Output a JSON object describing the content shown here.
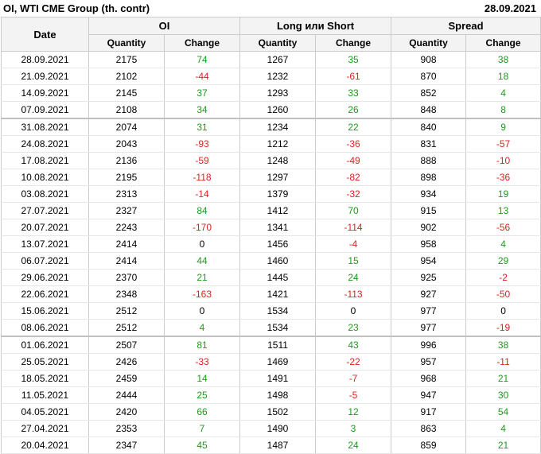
{
  "header": {
    "title": "OI, WTI CME Group (th. contr)",
    "date": "28.09.2021"
  },
  "columns": {
    "date": "Date",
    "groups": [
      "OI",
      "Long или Short",
      "Spread"
    ],
    "quantity": "Quantity",
    "change": "Change"
  },
  "rows": [
    {
      "date": "28.09.2021",
      "oi_q": "2175",
      "oi_c": "74",
      "ls_q": "1267",
      "ls_c": "35",
      "sp_q": "908",
      "sp_c": "38"
    },
    {
      "date": "21.09.2021",
      "oi_q": "2102",
      "oi_c": "-44",
      "ls_q": "1232",
      "ls_c": "-61",
      "sp_q": "870",
      "sp_c": "18"
    },
    {
      "date": "14.09.2021",
      "oi_q": "2145",
      "oi_c": "37",
      "ls_q": "1293",
      "ls_c": "33",
      "sp_q": "852",
      "sp_c": "4"
    },
    {
      "date": "07.09.2021",
      "oi_q": "2108",
      "oi_c": "34",
      "ls_q": "1260",
      "ls_c": "26",
      "sp_q": "848",
      "sp_c": "8"
    },
    {
      "date": "31.08.2021",
      "oi_q": "2074",
      "oi_c": "31",
      "ls_q": "1234",
      "ls_c": "22",
      "sp_q": "840",
      "sp_c": "9"
    },
    {
      "date": "24.08.2021",
      "oi_q": "2043",
      "oi_c": "-93",
      "ls_q": "1212",
      "ls_c": "-36",
      "sp_q": "831",
      "sp_c": "-57"
    },
    {
      "date": "17.08.2021",
      "oi_q": "2136",
      "oi_c": "-59",
      "ls_q": "1248",
      "ls_c": "-49",
      "sp_q": "888",
      "sp_c": "-10"
    },
    {
      "date": "10.08.2021",
      "oi_q": "2195",
      "oi_c": "-118",
      "ls_q": "1297",
      "ls_c": "-82",
      "sp_q": "898",
      "sp_c": "-36"
    },
    {
      "date": "03.08.2021",
      "oi_q": "2313",
      "oi_c": "-14",
      "ls_q": "1379",
      "ls_c": "-32",
      "sp_q": "934",
      "sp_c": "19"
    },
    {
      "date": "27.07.2021",
      "oi_q": "2327",
      "oi_c": "84",
      "ls_q": "1412",
      "ls_c": "70",
      "sp_q": "915",
      "sp_c": "13"
    },
    {
      "date": "20.07.2021",
      "oi_q": "2243",
      "oi_c": "-170",
      "ls_q": "1341",
      "ls_c": "-114",
      "sp_q": "902",
      "sp_c": "-56"
    },
    {
      "date": "13.07.2021",
      "oi_q": "2414",
      "oi_c": "0",
      "ls_q": "1456",
      "ls_c": "-4",
      "sp_q": "958",
      "sp_c": "4"
    },
    {
      "date": "06.07.2021",
      "oi_q": "2414",
      "oi_c": "44",
      "ls_q": "1460",
      "ls_c": "15",
      "sp_q": "954",
      "sp_c": "29"
    },
    {
      "date": "29.06.2021",
      "oi_q": "2370",
      "oi_c": "21",
      "ls_q": "1445",
      "ls_c": "24",
      "sp_q": "925",
      "sp_c": "-2"
    },
    {
      "date": "22.06.2021",
      "oi_q": "2348",
      "oi_c": "-163",
      "ls_q": "1421",
      "ls_c": "-113",
      "sp_q": "927",
      "sp_c": "-50"
    },
    {
      "date": "15.06.2021",
      "oi_q": "2512",
      "oi_c": "0",
      "ls_q": "1534",
      "ls_c": "0",
      "sp_q": "977",
      "sp_c": "0"
    },
    {
      "date": "08.06.2021",
      "oi_q": "2512",
      "oi_c": "4",
      "ls_q": "1534",
      "ls_c": "23",
      "sp_q": "977",
      "sp_c": "-19"
    },
    {
      "date": "01.06.2021",
      "oi_q": "2507",
      "oi_c": "81",
      "ls_q": "1511",
      "ls_c": "43",
      "sp_q": "996",
      "sp_c": "38"
    },
    {
      "date": "25.05.2021",
      "oi_q": "2426",
      "oi_c": "-33",
      "ls_q": "1469",
      "ls_c": "-22",
      "sp_q": "957",
      "sp_c": "-11"
    },
    {
      "date": "18.05.2021",
      "oi_q": "2459",
      "oi_c": "14",
      "ls_q": "1491",
      "ls_c": "-7",
      "sp_q": "968",
      "sp_c": "21"
    },
    {
      "date": "11.05.2021",
      "oi_q": "2444",
      "oi_c": "25",
      "ls_q": "1498",
      "ls_c": "-5",
      "sp_q": "947",
      "sp_c": "30"
    },
    {
      "date": "04.05.2021",
      "oi_q": "2420",
      "oi_c": "66",
      "ls_q": "1502",
      "ls_c": "12",
      "sp_q": "917",
      "sp_c": "54"
    },
    {
      "date": "27.04.2021",
      "oi_q": "2353",
      "oi_c": "7",
      "ls_q": "1490",
      "ls_c": "3",
      "sp_q": "863",
      "sp_c": "4"
    },
    {
      "date": "20.04.2021",
      "oi_q": "2347",
      "oi_c": "45",
      "ls_q": "1487",
      "ls_c": "24",
      "sp_q": "859",
      "sp_c": "21"
    }
  ],
  "month_separator_before": [
    4,
    17
  ],
  "colors": {
    "positive": "#1e9a1e",
    "negative": "#e02020",
    "neutral": "#000000"
  }
}
